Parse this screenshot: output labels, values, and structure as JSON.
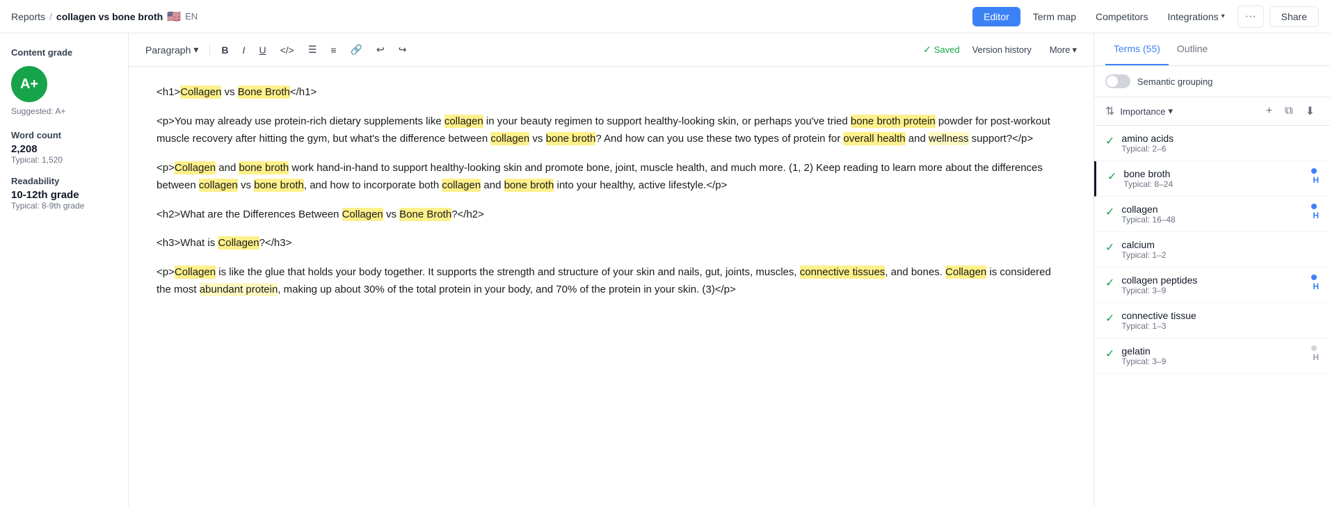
{
  "topnav": {
    "breadcrumb_reports": "Reports",
    "breadcrumb_sep": "/",
    "breadcrumb_title": "collagen vs bone broth",
    "breadcrumb_flag": "🇺🇸",
    "breadcrumb_lang": "EN",
    "btn_editor": "Editor",
    "btn_term_map": "Term map",
    "btn_competitors": "Competitors",
    "btn_integrations": "Integrations",
    "btn_dots": "···",
    "btn_share": "Share"
  },
  "toolbar": {
    "paragraph": "Paragraph",
    "saved": "Saved",
    "version_history": "Version history",
    "more": "More"
  },
  "left_sidebar": {
    "content_grade_label": "Content grade",
    "grade": "A+",
    "suggested": "Suggested: A+",
    "word_count_label": "Word count",
    "word_count_value": "2,208",
    "word_count_typical": "Typical: 1,520",
    "readability_label": "Readability",
    "readability_value": "10-12th grade",
    "readability_typical": "Typical: 8-9th grade"
  },
  "editor": {
    "lines": [
      "<h1>Collagen vs Bone Broth</h1>",
      "<p>You may already use protein-rich dietary supplements like collagen in your beauty regimen to support healthy-looking skin, or perhaps you've tried bone broth protein powder for post-workout muscle recovery after hitting the gym, but what's the difference between collagen vs bone broth? And how can you use these two types of protein for overall health and wellness support?</p>",
      "<p>Collagen and bone broth work hand-in-hand to support healthy-looking skin and promote bone, joint, muscle health, and much more. (1, 2) Keep reading to learn more about the differences between collagen vs bone broth, and how to incorporate both collagen and bone broth into your healthy, active lifestyle.</p>",
      "<h2>What are the Differences Between Collagen vs Bone Broth?</h2>",
      "<h3>What is Collagen?</h3>",
      "<p>Collagen is like the glue that holds your body together. It supports the strength and structure of your skin and nails, gut, joints, muscles, connective tissues, and bones. Collagen is considered the most abundant protein, making up about 30% of the total protein in your body, and 70% of the protein in your skin. (3)</p>"
    ]
  },
  "right_panel": {
    "tab_terms": "Terms (55)",
    "tab_outline": "Outline",
    "semantic_grouping": "Semantic grouping",
    "sort_label": "Importance",
    "terms": [
      {
        "name": "amino acids",
        "typical": "Typical: 2–6",
        "checked": true,
        "dot": "none",
        "h": ""
      },
      {
        "name": "bone broth",
        "typical": "Typical: 8–24",
        "checked": true,
        "dot": "blue",
        "h": "H",
        "selected": true
      },
      {
        "name": "collagen",
        "typical": "Typical: 16–48",
        "checked": true,
        "dot": "blue",
        "h": "H"
      },
      {
        "name": "calcium",
        "typical": "Typical: 1–2",
        "checked": true,
        "dot": "none",
        "h": ""
      },
      {
        "name": "collagen peptides",
        "typical": "Typical: 3–9",
        "checked": true,
        "dot": "blue",
        "h": "H"
      },
      {
        "name": "connective tissue",
        "typical": "Typical: 1–3",
        "checked": true,
        "dot": "none",
        "h": ""
      },
      {
        "name": "gelatin",
        "typical": "Typical: 3–9",
        "checked": true,
        "dot": "gray",
        "h": "H"
      }
    ]
  }
}
